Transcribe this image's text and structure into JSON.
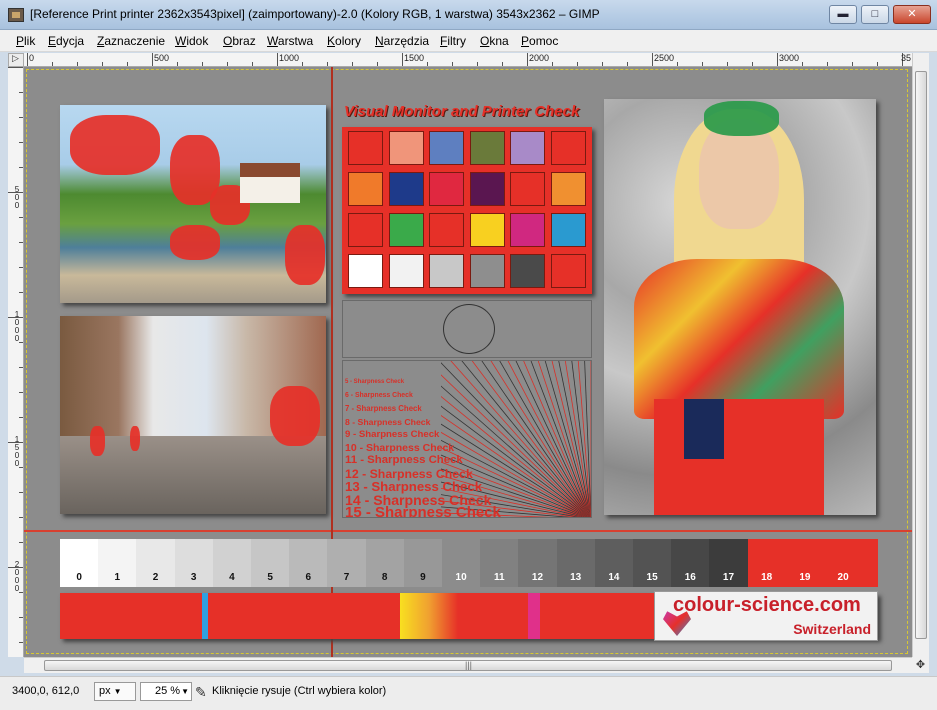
{
  "window": {
    "title": "[Reference Print printer 2362x3543pixel] (zaimportowany)-2.0 (Kolory RGB, 1 warstwa) 3543x2362 – GIMP",
    "min_glyph": "▬",
    "max_glyph": "□",
    "close_glyph": "✕"
  },
  "menu": [
    {
      "label": "Plik"
    },
    {
      "label": "Edycja"
    },
    {
      "label": "Zaznaczenie"
    },
    {
      "label": "Widok"
    },
    {
      "label": "Obraz"
    },
    {
      "label": "Warstwa"
    },
    {
      "label": "Kolory"
    },
    {
      "label": "Narzędzia"
    },
    {
      "label": "Filtry"
    },
    {
      "label": "Okna"
    },
    {
      "label": "Pomoc"
    }
  ],
  "hruler": {
    "labels": [
      "0",
      "500",
      "1000",
      "1500",
      "2000",
      "2500",
      "3000",
      "35"
    ]
  },
  "vruler": {
    "labels": [
      "5\n0\n0",
      "1\n0\n0\n0",
      "1\n5\n0\n0",
      "2\n0\n0\n0"
    ]
  },
  "canvas": {
    "chart_title": "Visual Monitor and Printer Check",
    "swatch_colors": [
      [
        "#e63028",
        "#f0957a",
        "#5e7fc0",
        "#6a7a3a",
        "#a88ac8",
        "#e63028"
      ],
      [
        "#f07a2a",
        "#1e3a8a",
        "#e02840",
        "#5a1650",
        "#e63028",
        "#f09030"
      ],
      [
        "#e63028",
        "#3aaa4a",
        "#e63028",
        "#f8d020",
        "#d02880",
        "#2a9ad0"
      ],
      [
        "#ffffff",
        "#f2f2f2",
        "#c8c8c8",
        "#8e8e8e",
        "#4a4a4a",
        "#e63028"
      ]
    ],
    "sharpness_lines": [
      "5 - Sharpness Check",
      "6 - Sharpness Check",
      "7 - Sharpness Check",
      "8 - Sharpness Check",
      "9 - Sharpness Check",
      "10 - Sharpness Check",
      "11 - Sharpness Check",
      "12 - Sharpness Check",
      "13 - Sharpness Check",
      "14 - Sharpness Check",
      "15 - Sharpness Check"
    ],
    "gray_scale": [
      "0",
      "1",
      "2",
      "3",
      "4",
      "5",
      "6",
      "7",
      "8",
      "9",
      "10",
      "11",
      "12",
      "13",
      "14",
      "15",
      "16",
      "17",
      "18",
      "19",
      "20"
    ],
    "logo_text": "colour-science.com",
    "logo_sub": "Switzerland"
  },
  "status": {
    "coords": "3400,0, 612,0",
    "unit": "px",
    "unit_arrow": "▼",
    "zoom": "25 %",
    "zoom_arrow": "▼",
    "hint": "Kliknięcie rysuje (Ctrl wybiera kolor)"
  },
  "icons": {
    "picker": "color-picker-icon",
    "navigate": "navigate-icon",
    "ruler_corner": "quick-mask-icon"
  },
  "colors": {
    "accent_red": "#e63028",
    "canvas_gray": "#8c8c8c",
    "titlebar": "#b4cbe4"
  }
}
